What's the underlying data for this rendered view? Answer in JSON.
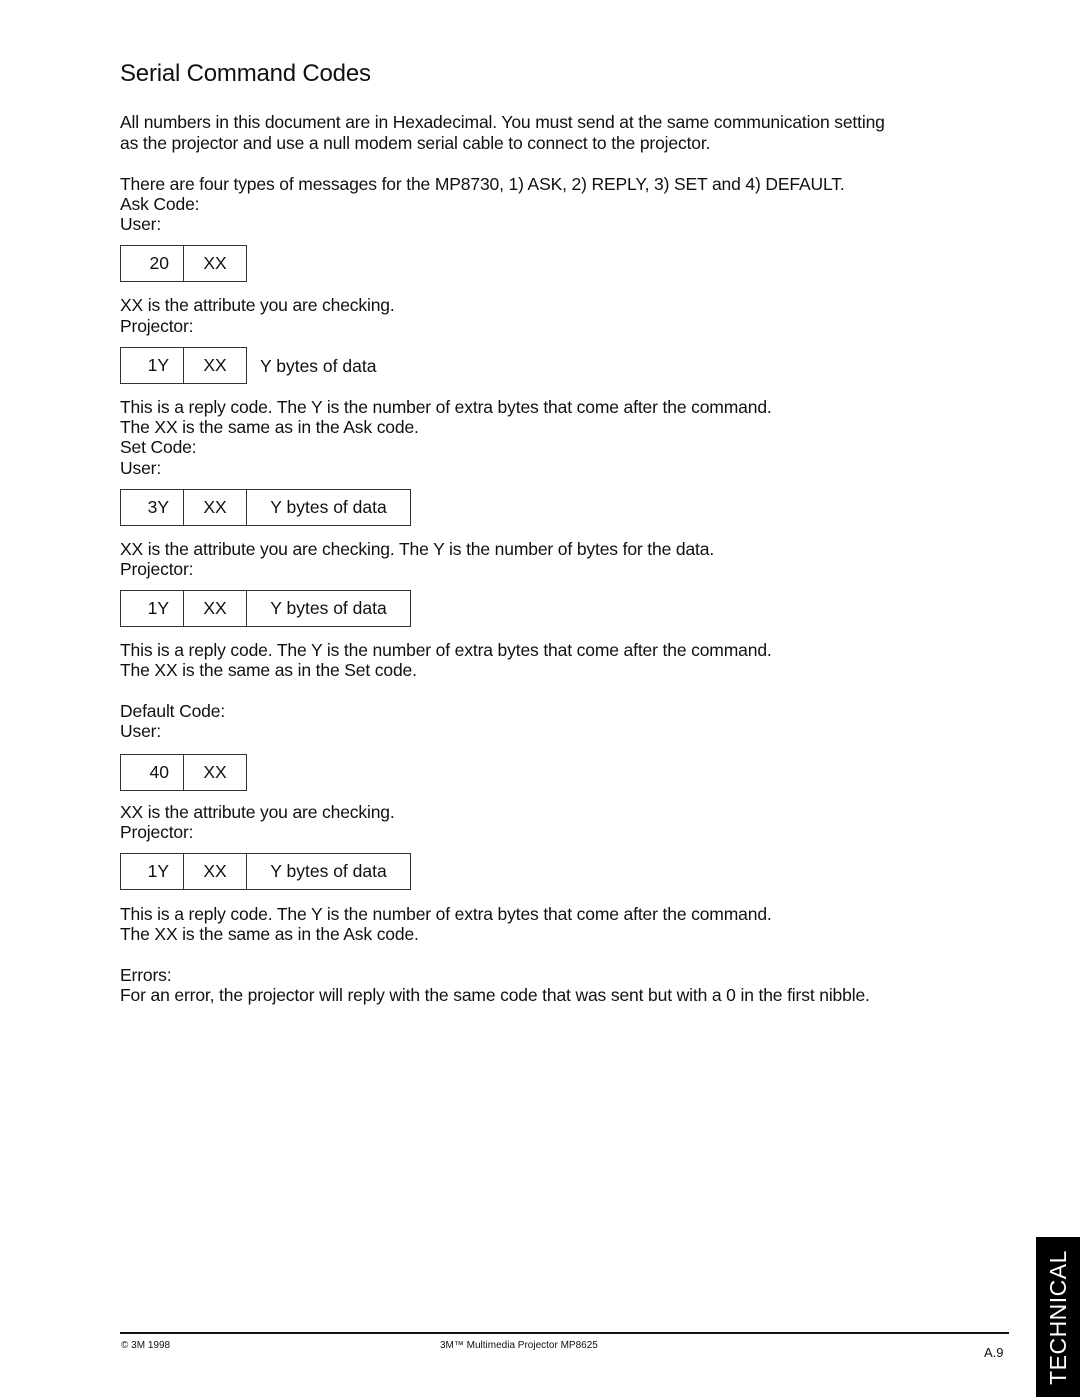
{
  "page": {
    "title": "Serial Command Codes",
    "intro": [
      "All numbers in this document  are in Hexadecimal.  You must send at the same communication setting",
      "as the projector and use a null modem serial cable to connect to the projector."
    ],
    "types_line": "There are four types of messages for the MP8730, 1) ASK, 2) REPLY,  3) SET and 4) DEFAULT."
  },
  "ask": {
    "heading": "Ask Code:",
    "user_label": "User:",
    "user_box": [
      "20",
      "XX"
    ],
    "user_note": "XX is the attribute you are checking.",
    "projector_label": "Projector:",
    "projector_box": [
      "1Y",
      "XX"
    ],
    "projector_box_trailing": "Y bytes of data",
    "reply_note": [
      "This is a reply code. The Y is the number of extra bytes that come after the command.",
      "The XX is the same as in the Ask code."
    ]
  },
  "set": {
    "heading": "Set Code:",
    "user_label": "User:",
    "user_box": [
      "3Y",
      "XX",
      "Y bytes of data"
    ],
    "user_note": "XX is the attribute you are checking. The Y is the number of bytes for the data.",
    "projector_label": "Projector:",
    "projector_box": [
      "1Y",
      "XX",
      "Y bytes of data"
    ],
    "reply_note": [
      "This is a reply code.  The Y is the number of extra bytes that come after the command.",
      "The XX is the same as in the Set code."
    ]
  },
  "default": {
    "heading": "Default Code:",
    "user_label": "User:",
    "user_box": [
      "40",
      "XX"
    ],
    "user_note": "XX is the attribute you are checking.",
    "projector_label": "Projector:",
    "projector_box": [
      "1Y",
      "XX",
      "Y bytes of data"
    ],
    "reply_note": [
      "This is a reply code.  The Y is the number of extra bytes that come after the command.",
      "The XX is the same as in the Ask code."
    ]
  },
  "errors": {
    "heading": "Errors:",
    "text": "For an error, the projector will reply with the same code that was sent but with a 0 in the first nibble."
  },
  "footer": {
    "copyright": "© 3M 1998",
    "product": "3M™ Multimedia Projector MP8625",
    "page_number": "A.9"
  },
  "side_tab": {
    "label": "TECHNICAL"
  }
}
